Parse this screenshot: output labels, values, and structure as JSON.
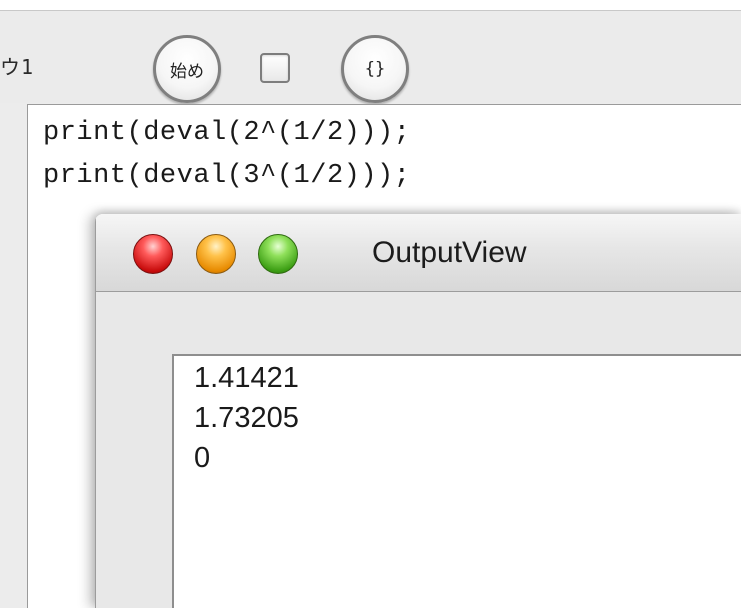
{
  "toolbar": {
    "label": "ウ1",
    "start_button_label": "始め",
    "braces_button_label": "{}"
  },
  "editor": {
    "lines": [
      "print(deval(2^(1/2)));",
      "print(deval(3^(1/2)));"
    ]
  },
  "output_window": {
    "title": "OutputView",
    "lines": [
      "1.41421",
      "1.73205",
      "0"
    ]
  }
}
